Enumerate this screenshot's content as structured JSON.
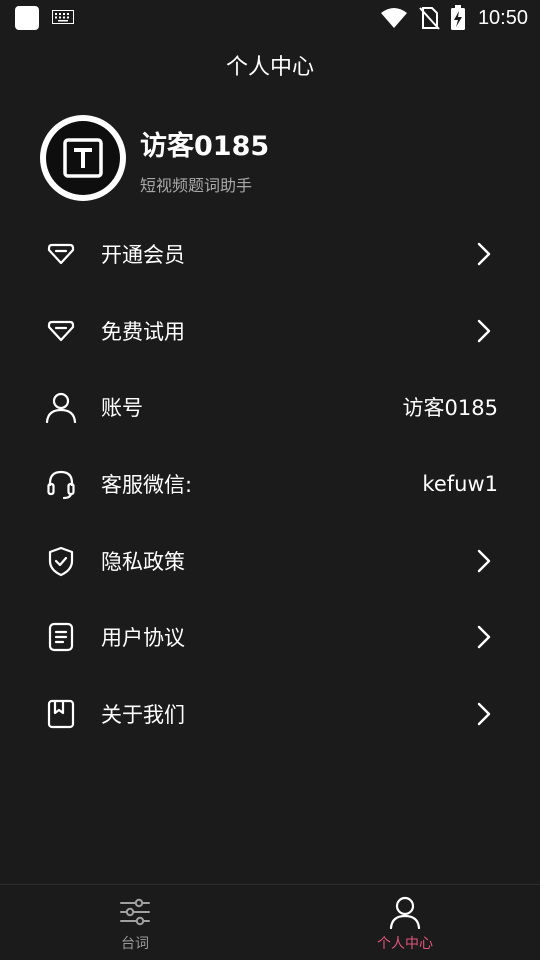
{
  "status_bar": {
    "time": "10:50",
    "icons": [
      "app-square-icon",
      "keyboard-icon",
      "wifi-icon",
      "no-sim-icon",
      "battery-charging-icon"
    ]
  },
  "header": {
    "title": "个人中心"
  },
  "profile": {
    "username": "访客0185",
    "subtitle": "短视频题词助手",
    "avatar_icon": "app-logo-t-icon"
  },
  "menu": [
    {
      "icon": "diamond-icon",
      "label": "开通会员",
      "value": "",
      "chevron": true
    },
    {
      "icon": "diamond-icon",
      "label": "免费试用",
      "value": "",
      "chevron": true
    },
    {
      "icon": "user-icon",
      "label": "账号",
      "value": "访客0185",
      "chevron": false
    },
    {
      "icon": "headset-icon",
      "label": "客服微信:",
      "value": "kefuw1",
      "chevron": false
    },
    {
      "icon": "shield-check-icon",
      "label": "隐私政策",
      "value": "",
      "chevron": true
    },
    {
      "icon": "document-icon",
      "label": "用户协议",
      "value": "",
      "chevron": true
    },
    {
      "icon": "bookmark-box-icon",
      "label": "关于我们",
      "value": "",
      "chevron": true
    }
  ],
  "bottom_nav": {
    "tabs": [
      {
        "label": "台词",
        "icon": "sliders-icon",
        "active": false
      },
      {
        "label": "个人中心",
        "icon": "user-icon",
        "active": true
      }
    ]
  },
  "colors": {
    "background": "#1b1b1b",
    "text_primary": "#ffffff",
    "text_secondary": "#a8a8a8",
    "accent_active": "#e0557d",
    "nav_inactive": "#9a9a9a"
  }
}
